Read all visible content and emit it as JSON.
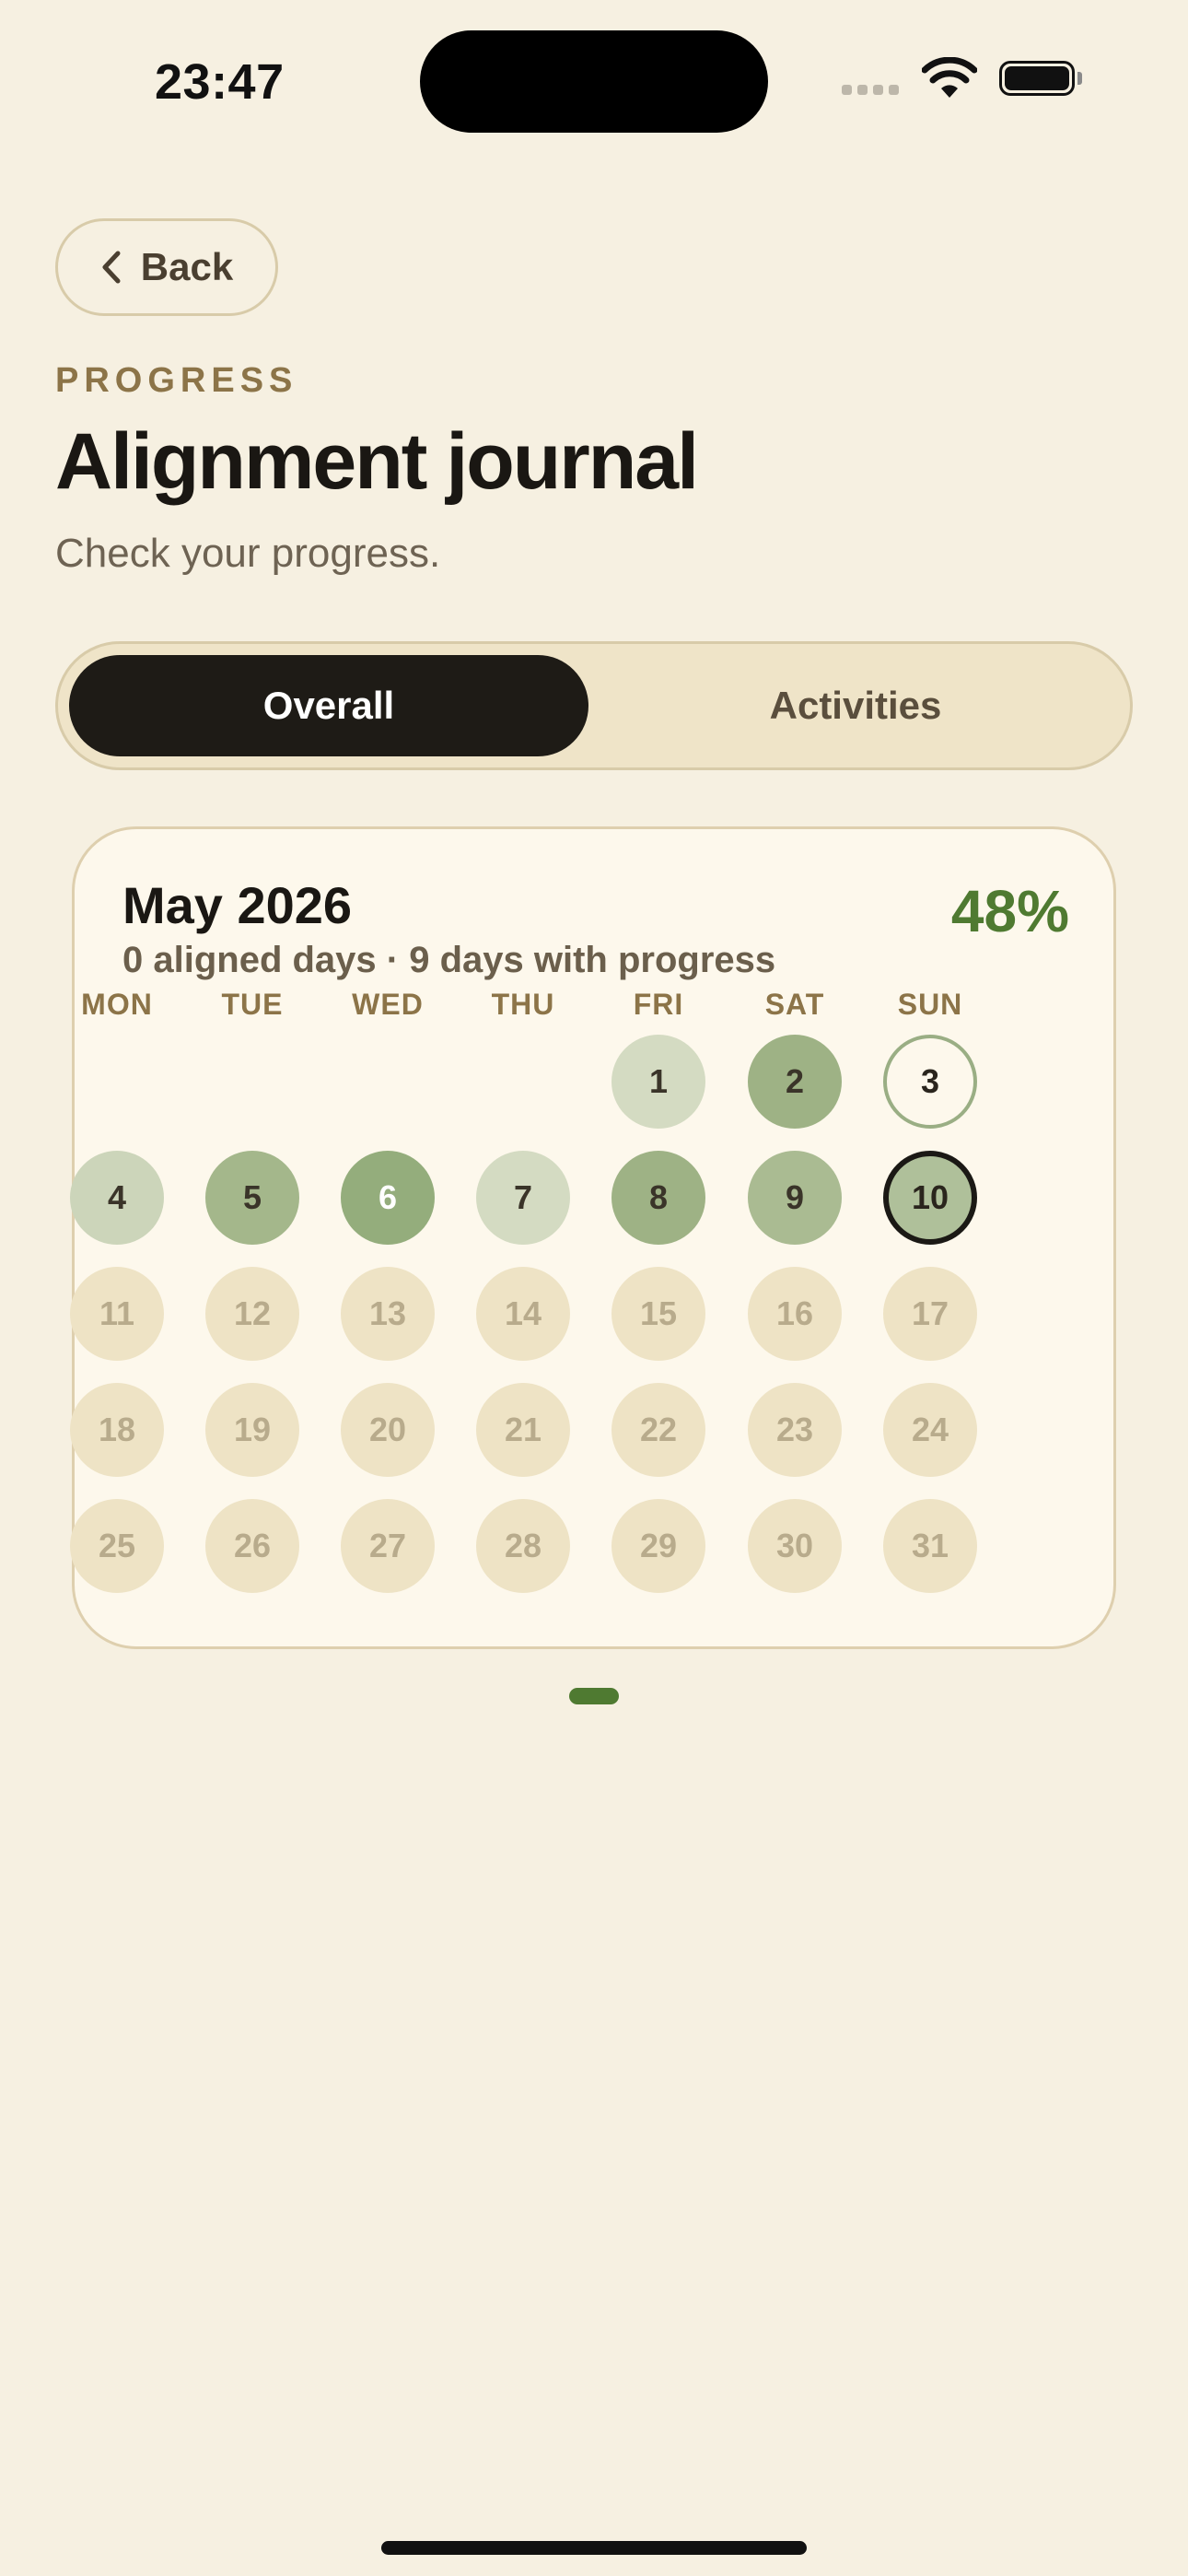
{
  "status_bar": {
    "time": "23:47"
  },
  "nav": {
    "back_label": "Back"
  },
  "header": {
    "eyebrow": "PROGRESS",
    "title": "Alignment journal",
    "subtitle": "Check your progress."
  },
  "tabs": [
    {
      "label": "Overall",
      "selected": true
    },
    {
      "label": "Activities",
      "selected": false
    }
  ],
  "calendar": {
    "month_label": "May 2026",
    "percent": "48%",
    "summary": "0 aligned days · 9 days with progress",
    "weekdays": [
      "MON",
      "TUE",
      "WED",
      "THU",
      "FRI",
      "SAT",
      "SUN"
    ],
    "days": [
      {
        "label": "1",
        "state": "progress"
      },
      {
        "label": "2",
        "state": "progress"
      },
      {
        "label": "3",
        "state": "ring"
      },
      {
        "label": "4",
        "state": "progress"
      },
      {
        "label": "5",
        "state": "progress"
      },
      {
        "label": "6",
        "state": "progress"
      },
      {
        "label": "7",
        "state": "progress"
      },
      {
        "label": "8",
        "state": "progress"
      },
      {
        "label": "9",
        "state": "progress"
      },
      {
        "label": "10",
        "state": "today"
      },
      {
        "label": "11",
        "state": "future"
      },
      {
        "label": "12",
        "state": "future"
      },
      {
        "label": "13",
        "state": "future"
      },
      {
        "label": "14",
        "state": "future"
      },
      {
        "label": "15",
        "state": "future"
      },
      {
        "label": "16",
        "state": "future"
      },
      {
        "label": "17",
        "state": "future"
      },
      {
        "label": "18",
        "state": "future"
      },
      {
        "label": "19",
        "state": "future"
      },
      {
        "label": "20",
        "state": "future"
      },
      {
        "label": "21",
        "state": "future"
      },
      {
        "label": "22",
        "state": "future"
      },
      {
        "label": "23",
        "state": "future"
      },
      {
        "label": "24",
        "state": "future"
      },
      {
        "label": "25",
        "state": "future"
      },
      {
        "label": "26",
        "state": "future"
      },
      {
        "label": "27",
        "state": "future"
      },
      {
        "label": "28",
        "state": "future"
      },
      {
        "label": "29",
        "state": "future"
      },
      {
        "label": "30",
        "state": "future"
      },
      {
        "label": "31",
        "state": "future"
      }
    ]
  },
  "colors": {
    "background": "#F6F0E1",
    "accent_green": "#4F7A31",
    "tab_selected": "#1E1B16"
  }
}
